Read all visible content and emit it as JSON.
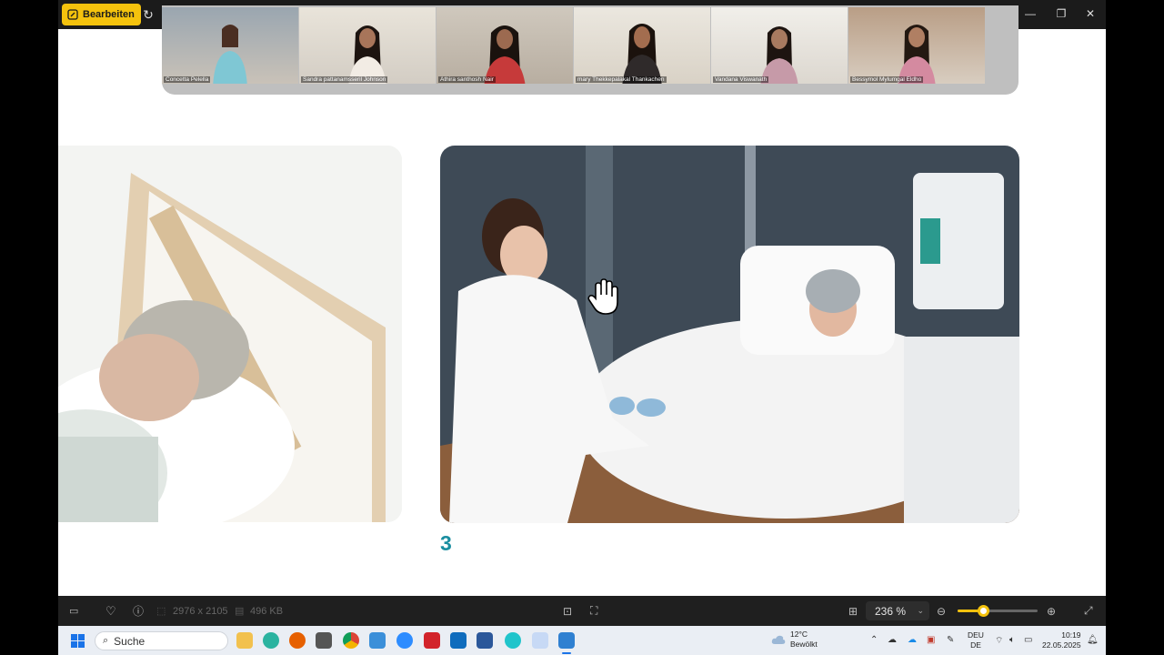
{
  "titlebar": {
    "edit_label": "Bearbeiten",
    "minimize": "—",
    "maximize": "❐",
    "close": "✕"
  },
  "meeting": {
    "participants": [
      {
        "name": "Concetta Pelella"
      },
      {
        "name": "Sandra pattanamsseril Johnson"
      },
      {
        "name": "Athira santhosh Nair"
      },
      {
        "name": "mary Thekkepalakal Thankachen"
      },
      {
        "name": "Vandana Viswanath"
      },
      {
        "name": "Bessymol Mylumgal Eldho"
      }
    ]
  },
  "slide": {
    "page_number": "3"
  },
  "viewer_toolbar": {
    "dimensions": "2976 x 2105",
    "file_size": "496 KB",
    "zoom": "236 %",
    "zoom_level": 0.32
  },
  "taskbar": {
    "search_placeholder": "Suche",
    "weather_temp": "12°C",
    "weather_text": "Bewölkt",
    "lang_top": "DEU",
    "lang_bottom": "DE",
    "time": "10:19",
    "date": "22.05.2025"
  },
  "colors": {
    "accent": "#f4c20d",
    "slide_number": "#1a8ea0",
    "titlebar": "#1b1b1b",
    "toolbar": "#1f1f1f",
    "taskbar": "#eaeef4"
  }
}
